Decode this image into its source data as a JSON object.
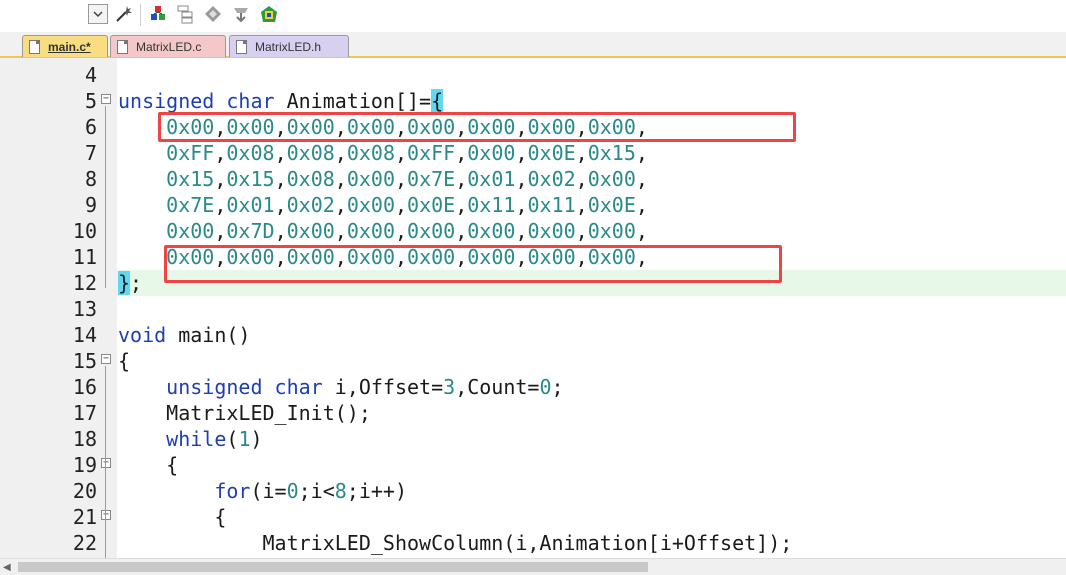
{
  "toolbar": {
    "icons": [
      "dropdown-icon",
      "magic-wand-icon",
      "build-icon",
      "manage-icon",
      "diamond-icon",
      "download-icon",
      "rebuild-icon"
    ]
  },
  "tabs": [
    {
      "label": "main.c*",
      "active": true,
      "color": "#f8dd82"
    },
    {
      "label": "MatrixLED.c",
      "active": false,
      "color": "#f4c8c8"
    },
    {
      "label": "MatrixLED.h",
      "active": false,
      "color": "#d8d0f0"
    }
  ],
  "lines": [
    {
      "num": "4",
      "text": ""
    },
    {
      "num": "5",
      "text": "unsigned char Animation[]={"
    },
    {
      "num": "6",
      "text": "    0x00,0x00,0x00,0x00,0x00,0x00,0x00,0x00,"
    },
    {
      "num": "7",
      "text": "    0xFF,0x08,0x08,0x08,0xFF,0x00,0x0E,0x15,"
    },
    {
      "num": "8",
      "text": "    0x15,0x15,0x08,0x00,0x7E,0x01,0x02,0x00,"
    },
    {
      "num": "9",
      "text": "    0x7E,0x01,0x02,0x00,0x0E,0x11,0x11,0x0E,"
    },
    {
      "num": "10",
      "text": "    0x00,0x7D,0x00,0x00,0x00,0x00,0x00,0x00,"
    },
    {
      "num": "11",
      "text": "    0x00,0x00,0x00,0x00,0x00,0x00,0x00,0x00,"
    },
    {
      "num": "12",
      "text": "};"
    },
    {
      "num": "13",
      "text": ""
    },
    {
      "num": "14",
      "text": "void main()"
    },
    {
      "num": "15",
      "text": "{"
    },
    {
      "num": "16",
      "text": "    unsigned char i,Offset=3,Count=0;"
    },
    {
      "num": "17",
      "text": "    MatrixLED_Init();"
    },
    {
      "num": "18",
      "text": "    while(1)"
    },
    {
      "num": "19",
      "text": "    {"
    },
    {
      "num": "20",
      "text": "        for(i=0;i<8;i++)"
    },
    {
      "num": "21",
      "text": "        {"
    },
    {
      "num": "22",
      "text": "            MatrixLED_ShowColumn(i,Animation[i+Offset]);"
    }
  ],
  "colors": {
    "keyword": "#1e3fb0",
    "number": "#2a8a8a",
    "highlight_box": "#ee4444",
    "current_line": "#e8f8e8",
    "brace_match": "#60d8f0"
  }
}
